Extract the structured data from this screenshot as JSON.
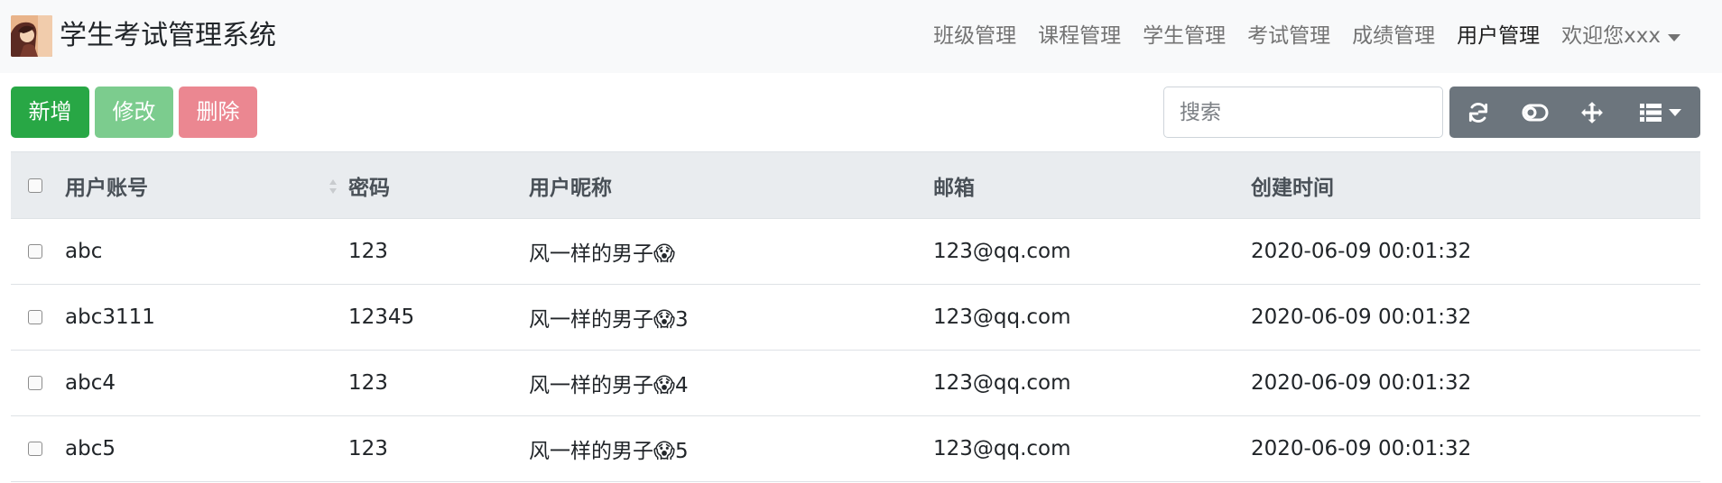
{
  "navbar": {
    "brand_title": "学生考试管理系统",
    "links": [
      {
        "label": "班级管理",
        "active": false
      },
      {
        "label": "课程管理",
        "active": false
      },
      {
        "label": "学生管理",
        "active": false
      },
      {
        "label": "考试管理",
        "active": false
      },
      {
        "label": "成绩管理",
        "active": false
      },
      {
        "label": "用户管理",
        "active": true
      }
    ],
    "user_menu": "欢迎您xxx"
  },
  "toolbar": {
    "add_label": "新增",
    "edit_label": "修改",
    "delete_label": "删除",
    "search_placeholder": "搜索",
    "icons": [
      "refresh-icon",
      "toggle-icon",
      "move-icon",
      "columns-icon"
    ]
  },
  "table": {
    "headers": {
      "account": "用户账号",
      "password": "密码",
      "nickname": "用户昵称",
      "email": "邮箱",
      "created": "创建时间"
    },
    "rows": [
      {
        "account": "abc",
        "password": "123",
        "nickname": "风一样的男子😱",
        "email": "123@qq.com",
        "created": "2020-06-09 00:01:32"
      },
      {
        "account": "abc3111",
        "password": "12345",
        "nickname": "风一样的男子😱3",
        "email": "123@qq.com",
        "created": "2020-06-09 00:01:32"
      },
      {
        "account": "abc4",
        "password": "123",
        "nickname": "风一样的男子😱4",
        "email": "123@qq.com",
        "created": "2020-06-09 00:01:32"
      },
      {
        "account": "abc5",
        "password": "123",
        "nickname": "风一样的男子😱5",
        "email": "123@qq.com",
        "created": "2020-06-09 00:01:32"
      }
    ]
  },
  "colors": {
    "success": "#28a745",
    "danger": "#dc3545",
    "secondary": "#6c757d",
    "navbar_bg": "#f8f9fa",
    "table_head_bg": "#e9ecef"
  }
}
